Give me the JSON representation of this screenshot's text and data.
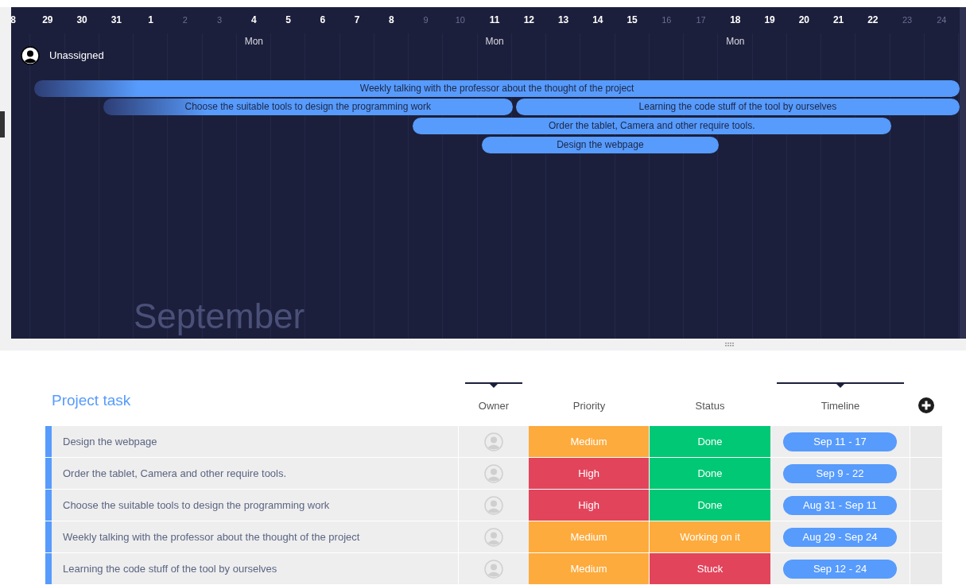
{
  "gantt": {
    "days": [
      {
        "label": "8",
        "weekend": false
      },
      {
        "label": "29",
        "weekend": false
      },
      {
        "label": "30",
        "weekend": false
      },
      {
        "label": "31",
        "weekend": false
      },
      {
        "label": "1",
        "weekend": false
      },
      {
        "label": "2",
        "weekend": true
      },
      {
        "label": "3",
        "weekend": true
      },
      {
        "label": "4",
        "weekend": false,
        "weekday": "Mon"
      },
      {
        "label": "5",
        "weekend": false
      },
      {
        "label": "6",
        "weekend": false
      },
      {
        "label": "7",
        "weekend": false
      },
      {
        "label": "8",
        "weekend": false
      },
      {
        "label": "9",
        "weekend": true
      },
      {
        "label": "10",
        "weekend": true
      },
      {
        "label": "11",
        "weekend": false,
        "weekday": "Mon"
      },
      {
        "label": "12",
        "weekend": false
      },
      {
        "label": "13",
        "weekend": false
      },
      {
        "label": "14",
        "weekend": false
      },
      {
        "label": "15",
        "weekend": false
      },
      {
        "label": "16",
        "weekend": true
      },
      {
        "label": "17",
        "weekend": true
      },
      {
        "label": "18",
        "weekend": false,
        "weekday": "Mon"
      },
      {
        "label": "19",
        "weekend": false
      },
      {
        "label": "20",
        "weekend": false
      },
      {
        "label": "21",
        "weekend": false
      },
      {
        "label": "22",
        "weekend": false
      },
      {
        "label": "23",
        "weekend": true
      },
      {
        "label": "24",
        "weekend": true
      }
    ],
    "group": {
      "name": "Unassigned",
      "bars": [
        {
          "label": "Weekly talking with the professor about the thought of the project",
          "faded_start": true
        },
        {
          "label": "Choose the suitable tools to design the programming work",
          "faded_start": true
        },
        {
          "label": "Learning the code stuff of the tool by ourselves",
          "faded_start": false
        },
        {
          "label": "Order the tablet, Camera and other require tools.",
          "faded_start": false
        },
        {
          "label": "Design the webpage",
          "faded_start": false
        }
      ]
    },
    "month": "September"
  },
  "table": {
    "title": "Project task",
    "columns": [
      {
        "label": "Owner",
        "marked": true
      },
      {
        "label": "Priority",
        "marked": false
      },
      {
        "label": "Status",
        "marked": false
      },
      {
        "label": "Timeline",
        "marked": true
      }
    ],
    "rows": [
      {
        "task": "Design the webpage",
        "priority": {
          "label": "Medium",
          "color": "#fdab3d"
        },
        "status": {
          "label": "Done",
          "color": "#00c875"
        },
        "timeline": "Sep 11 - 17"
      },
      {
        "task": "Order the tablet, Camera and other require tools.",
        "priority": {
          "label": "High",
          "color": "#e2445c"
        },
        "status": {
          "label": "Done",
          "color": "#00c875"
        },
        "timeline": "Sep 9 - 22"
      },
      {
        "task": "Choose the suitable tools to design the programming work",
        "priority": {
          "label": "High",
          "color": "#e2445c"
        },
        "status": {
          "label": "Done",
          "color": "#00c875"
        },
        "timeline": "Aug 31 - Sep 11"
      },
      {
        "task": "Weekly talking with the professor about the thought of the project",
        "priority": {
          "label": "Medium",
          "color": "#fdab3d"
        },
        "status": {
          "label": "Working on it",
          "color": "#fdab3d"
        },
        "timeline": "Aug 29 - Sep 24"
      },
      {
        "task": "Learning the code stuff of the tool by ourselves",
        "priority": {
          "label": "Medium",
          "color": "#fdab3d"
        },
        "status": {
          "label": "Stuck",
          "color": "#e2445c"
        },
        "timeline": "Sep 12 - 24"
      }
    ]
  }
}
